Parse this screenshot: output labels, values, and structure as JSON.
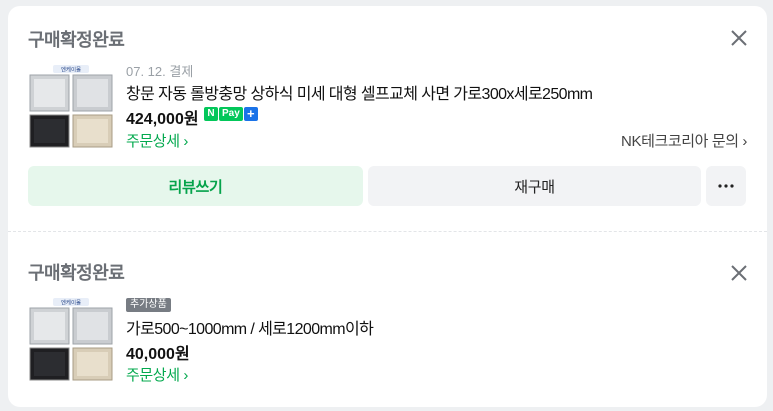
{
  "orders": [
    {
      "status": "구매확정완료",
      "date": "07. 12. 결제",
      "product_name": "창문 자동 롤방충망 상하식 미세 대형 셀프교체 사면 가로300x세로250mm",
      "price": "424,000원",
      "payment_badge": {
        "n": "N",
        "pay": "Pay",
        "plus": "+"
      },
      "detail_link": "주문상세 ›",
      "seller_link": "NK테크코리아 문의 ›",
      "buttons": {
        "review": "리뷰쓰기",
        "rebuy": "재구매",
        "more": "···"
      },
      "thumbnail_logo": "엔케이몰"
    },
    {
      "status": "구매확정완료",
      "badge": "추가상품",
      "product_name": "가로500~1000mm / 세로1200mm이하",
      "price": "40,000원",
      "detail_link": "주문상세 ›",
      "thumbnail_logo": "엔케이몰"
    }
  ],
  "icons": {
    "close": "close-icon",
    "more": "more-dots-icon"
  },
  "colors": {
    "accent": "#03a94e",
    "review_bg": "#e6f7ec",
    "npay": "#03c75a"
  }
}
